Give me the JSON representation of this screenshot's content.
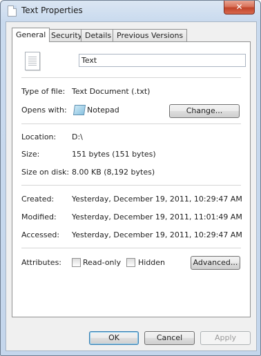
{
  "window": {
    "title": "Text Properties",
    "close_glyph": "✕"
  },
  "tabs": [
    {
      "label": "General"
    },
    {
      "label": "Security"
    },
    {
      "label": "Details"
    },
    {
      "label": "Previous Versions"
    }
  ],
  "general": {
    "file_name": "Text",
    "type_label": "Type of file:",
    "type_value": "Text Document (.txt)",
    "opens_label": "Opens with:",
    "opens_value": "Notepad",
    "change_button": "Change...",
    "location_label": "Location:",
    "location_value": "D:\\",
    "size_label": "Size:",
    "size_value": "151 bytes (151 bytes)",
    "size_disk_label": "Size on disk:",
    "size_disk_value": "8.00 KB (8,192 bytes)",
    "created_label": "Created:",
    "created_value": "Yesterday, December 19, 2011, 10:29:47 AM",
    "modified_label": "Modified:",
    "modified_value": "Yesterday, December 19, 2011, 11:01:49 AM",
    "accessed_label": "Accessed:",
    "accessed_value": "Yesterday, December 19, 2011, 10:29:47 AM",
    "attributes_label": "Attributes:",
    "readonly_label": "Read-only",
    "hidden_label": "Hidden",
    "advanced_button": "Advanced..."
  },
  "footer": {
    "ok_label": "OK",
    "cancel_label": "Cancel",
    "apply_label": "Apply"
  },
  "colors": {
    "window_frame": "#c4d6ec",
    "close_button": "#c1442a",
    "default_button_border": "#3c7fb1"
  },
  "icons": {
    "title": "text-file-icon",
    "file": "text-file-icon",
    "opens_with": "notepad-icon"
  }
}
